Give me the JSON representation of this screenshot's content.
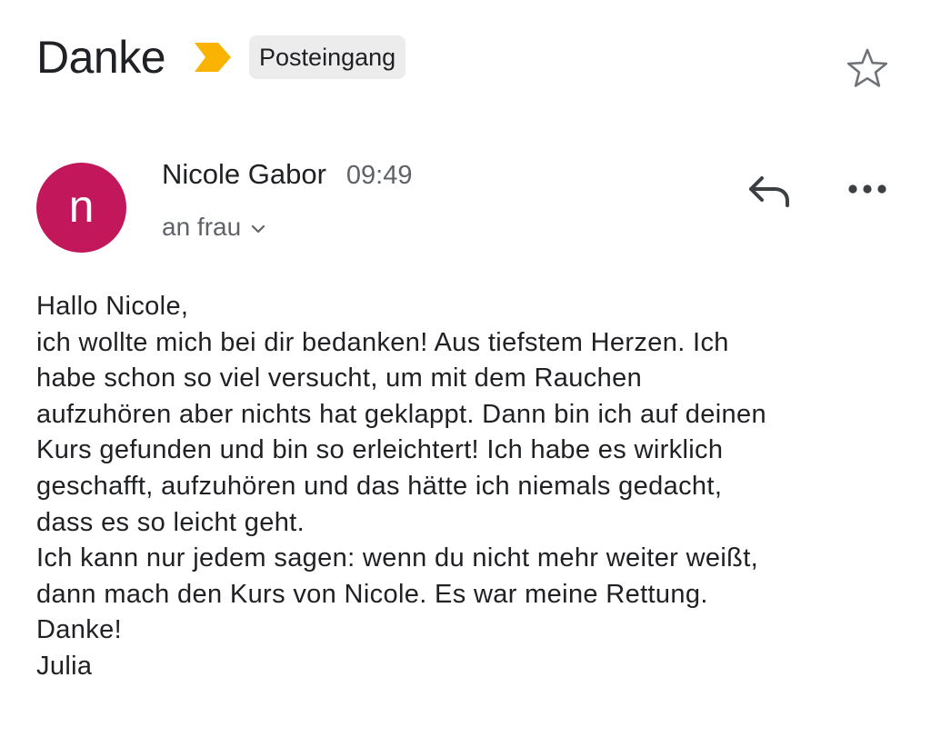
{
  "email": {
    "subject": "Danke",
    "label": "Posteingang",
    "sender_name": "Nicole Gabor",
    "sender_initial": "n",
    "time": "09:49",
    "recipient": "an frau",
    "body_lines": [
      "Hallo Nicole,",
      "ich wollte mich bei dir bedanken! Aus tiefstem Herzen. Ich",
      "habe schon so viel versucht, um mit dem Rauchen",
      "aufzuhören aber nichts hat geklappt. Dann bin ich auf deinen",
      "Kurs gefunden und bin so erleichtert! Ich habe es wirklich",
      "geschafft, aufzuhören und das hätte ich niemals gedacht,",
      "dass es so leicht geht.",
      "Ich kann nur jedem sagen: wenn du nicht mehr weiter weißt,",
      "dann mach den Kurs von Nicole. Es war meine Rettung.",
      "Danke!",
      "Julia"
    ]
  },
  "icons": {
    "importance": "importance-marker-icon",
    "star": "star-icon",
    "reply": "reply-icon",
    "more": "more-options-icon",
    "expand": "chevron-down-icon"
  },
  "colors": {
    "avatar": "#c2185b",
    "importance": "#f9b300",
    "chip_background": "#ececec",
    "secondary_text": "#5f6368",
    "primary_text": "#202124"
  }
}
